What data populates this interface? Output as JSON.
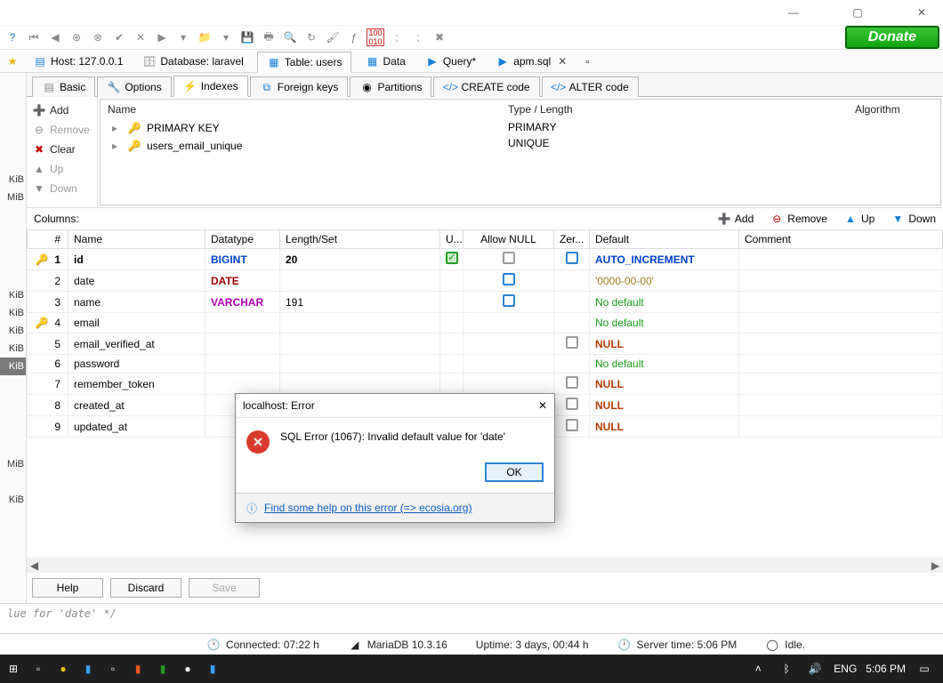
{
  "titlebar": {
    "min": "—",
    "max": "▢",
    "close": "✕"
  },
  "donate_label": "Donate",
  "locbar": {
    "host_label": "Host: 127.0.0.1",
    "db_label": "Database: laravel",
    "table_label": "Table: users",
    "data_label": "Data",
    "query_label": "Query*",
    "apm_label": "apm.sql"
  },
  "tabs": {
    "basic": "Basic",
    "options": "Options",
    "indexes": "Indexes",
    "fk": "Foreign keys",
    "partitions": "Partitions",
    "create": "CREATE code",
    "alter": "ALTER code"
  },
  "idxside": {
    "add": "Add",
    "remove": "Remove",
    "clear": "Clear",
    "up": "Up",
    "down": "Down"
  },
  "idxhead": {
    "name": "Name",
    "type": "Type / Length",
    "algo": "Algorithm"
  },
  "idxrows": [
    {
      "name": "PRIMARY KEY",
      "type": "PRIMARY"
    },
    {
      "name": "users_email_unique",
      "type": "UNIQUE"
    }
  ],
  "coltools": {
    "label": "Columns:",
    "add": "Add",
    "remove": "Remove",
    "up": "Up",
    "down": "Down"
  },
  "colhead": {
    "hash": "#",
    "name": "Name",
    "dtype": "Datatype",
    "len": "Length/Set",
    "uns": "U...",
    "null": "Allow NULL",
    "zero": "Zer...",
    "def": "Default",
    "com": "Comment"
  },
  "cols": [
    {
      "n": "1",
      "key": "gold",
      "name": "id",
      "dt": "BIGINT",
      "dtc": "bluetxt",
      "len": "20",
      "uns": "green",
      "null": "gray",
      "zero": "blue",
      "def": "AUTO_INCREMENT",
      "defc": "defblue"
    },
    {
      "n": "2",
      "key": "",
      "name": "date",
      "dt": "DATE",
      "dtc": "datered",
      "len": "",
      "uns": "",
      "null": "blue",
      "zero": "",
      "def": "'0000-00-00'",
      "defc": "defred"
    },
    {
      "n": "3",
      "key": "",
      "name": "name",
      "dt": "VARCHAR",
      "dtc": "datevch",
      "len": "191",
      "uns": "",
      "null": "blue",
      "zero": "",
      "def": "No default",
      "defc": "defgreen"
    },
    {
      "n": "4",
      "key": "red",
      "name": "email",
      "dt": "",
      "dtc": "",
      "len": "",
      "uns": "",
      "null": "",
      "zero": "",
      "def": "No default",
      "defc": "defgreen"
    },
    {
      "n": "5",
      "key": "",
      "name": "email_verified_at",
      "dt": "",
      "dtc": "",
      "len": "",
      "uns": "",
      "null": "",
      "zero": "gray",
      "def": "NULL",
      "defc": "defnull"
    },
    {
      "n": "6",
      "key": "",
      "name": "password",
      "dt": "",
      "dtc": "",
      "len": "",
      "uns": "",
      "null": "",
      "zero": "",
      "def": "No default",
      "defc": "defgreen"
    },
    {
      "n": "7",
      "key": "",
      "name": "remember_token",
      "dt": "",
      "dtc": "",
      "len": "",
      "uns": "",
      "null": "",
      "zero": "gray",
      "def": "NULL",
      "defc": "defnull"
    },
    {
      "n": "8",
      "key": "",
      "name": "created_at",
      "dt": "",
      "dtc": "",
      "len": "",
      "uns": "",
      "null": "",
      "zero": "gray",
      "def": "NULL",
      "defc": "defnull"
    },
    {
      "n": "9",
      "key": "",
      "name": "updated_at",
      "dt": "",
      "dtc": "",
      "len": "",
      "uns": "",
      "null": "",
      "zero": "gray",
      "def": "NULL",
      "defc": "defnull"
    }
  ],
  "bottom": {
    "help": "Help",
    "discard": "Discard",
    "save": "Save"
  },
  "sqlstrip": "lue for 'date' */",
  "status": {
    "conn": "Connected: 07:22 h",
    "db": "MariaDB 10.3.16",
    "uptime": "Uptime: 3 days, 00:44 h",
    "stime": "Server time: 5:06 PM",
    "idle": "Idle."
  },
  "sidebar": {
    "u0": "KiB",
    "u1": "MiB",
    "u2": "KiB",
    "u3": "KiB",
    "u4": "KiB",
    "u5": "KiB",
    "u6": "MiB",
    "u7": "KiB"
  },
  "dialog": {
    "title": "localhost: Error",
    "msg": "SQL Error (1067): Invalid default value for 'date'",
    "ok": "OK",
    "help": "Find some help on this error (=> ecosia.org)"
  },
  "taskbar": {
    "lang": "ENG",
    "time": "5:06 PM"
  }
}
